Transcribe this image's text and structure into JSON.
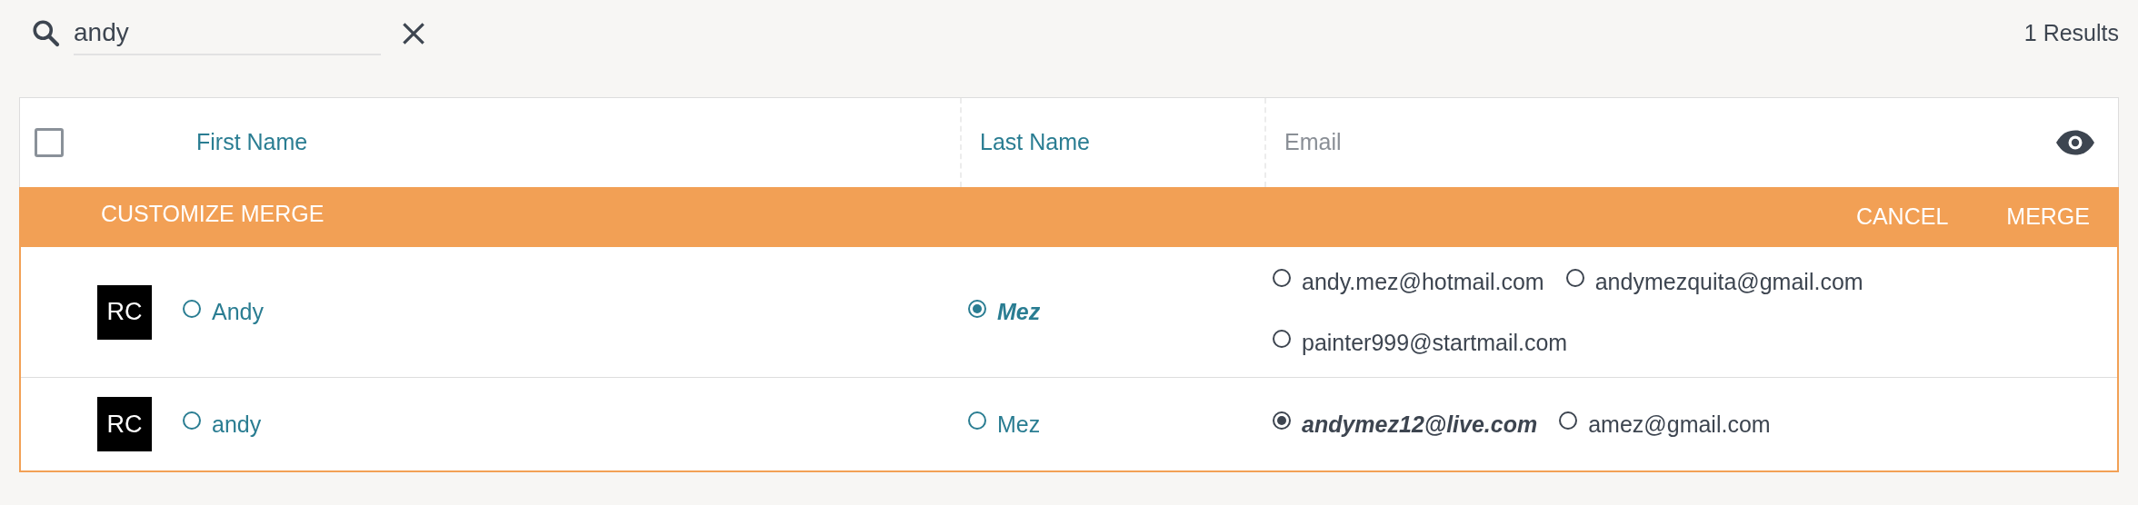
{
  "search": {
    "value": "andy"
  },
  "results": "1 Results",
  "table": {
    "select_all": {
      "checked": false
    },
    "columns": [
      {
        "label": "First Name",
        "kind": "link"
      },
      {
        "label": "Last Name",
        "kind": "link"
      },
      {
        "label": "Email",
        "kind": "plain"
      }
    ],
    "merge_bar": {
      "title": "CUSTOMIZE MERGE",
      "buttons": [
        "CANCEL",
        "MERGE"
      ]
    },
    "rows": [
      {
        "avatar": "RC",
        "first_names": [
          {
            "text": "Andy",
            "selected": false
          }
        ],
        "last_names": [
          {
            "text": "Mez",
            "selected": true
          }
        ],
        "emails": [
          {
            "text": "andy.mez@hotmail.com",
            "selected": false
          },
          {
            "text": "andymezquita@gmail.com",
            "selected": false
          },
          {
            "text": "painter999@startmail.com",
            "selected": false
          }
        ]
      },
      {
        "avatar": "RC",
        "first_names": [
          {
            "text": "andy",
            "selected": false
          }
        ],
        "last_names": [
          {
            "text": "Mez",
            "selected": false
          }
        ],
        "emails": [
          {
            "text": "andymez12@live.com",
            "selected": true
          },
          {
            "text": "amez@gmail.com",
            "selected": false
          }
        ]
      }
    ]
  }
}
